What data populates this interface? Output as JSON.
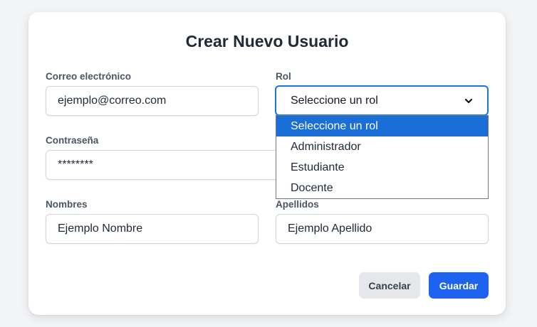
{
  "form": {
    "title": "Crear Nuevo Usuario",
    "email": {
      "label": "Correo electrónico",
      "value": "ejemplo@correo.com"
    },
    "role": {
      "label": "Rol",
      "selected": "Seleccione un rol",
      "options": [
        "Seleccione un rol",
        "Administrador",
        "Estudiante",
        "Docente"
      ]
    },
    "password": {
      "label": "Contraseña",
      "value": "********"
    },
    "first_name": {
      "label": "Nombres",
      "value": "Ejemplo Nombre"
    },
    "last_name": {
      "label": "Apellidos",
      "value": "Ejemplo Apellido"
    },
    "cancel_label": "Cancelar",
    "save_label": "Guardar"
  },
  "colors": {
    "primary": "#1e63f0",
    "focus": "#1a73e8",
    "option_highlight": "#1a6ed8",
    "cancel_bg": "#e5e7eb"
  },
  "icons": {
    "select_arrow": "chevron-down-icon"
  }
}
